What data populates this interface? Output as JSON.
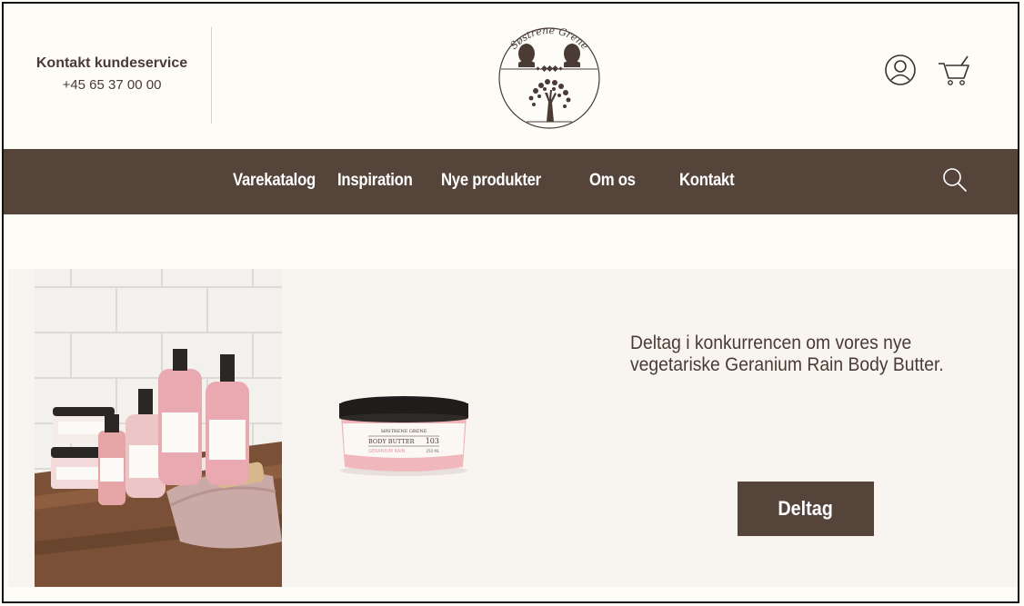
{
  "header": {
    "contact_title": "Kontakt kundeservice",
    "contact_phone": "+45 65 37 00 00",
    "logo_text": "Søstrene Grene",
    "account_icon": "user-circle-icon",
    "cart_icon": "shopping-cart-icon"
  },
  "nav": {
    "items": [
      {
        "label": "Varekatalog"
      },
      {
        "label": "Inspiration"
      },
      {
        "label": "Nye produkter"
      },
      {
        "label": "Om os"
      },
      {
        "label": "Kontakt"
      }
    ],
    "search_icon": "search-icon"
  },
  "banner": {
    "headline": "Deltag i konkurrencen om vores nye vegetariske Geranium Rain Body Butter.",
    "cta_label": "Deltag",
    "product_label": {
      "brand": "SØSTRENE GRENE",
      "name": "BODY BUTTER",
      "number": "103",
      "variant": "GERANIUM RAIN",
      "volume": "250 ML"
    }
  },
  "colors": {
    "brand_brown": "#54443a",
    "background": "#fdfcf7",
    "banner_bg": "#f8f5f0"
  }
}
